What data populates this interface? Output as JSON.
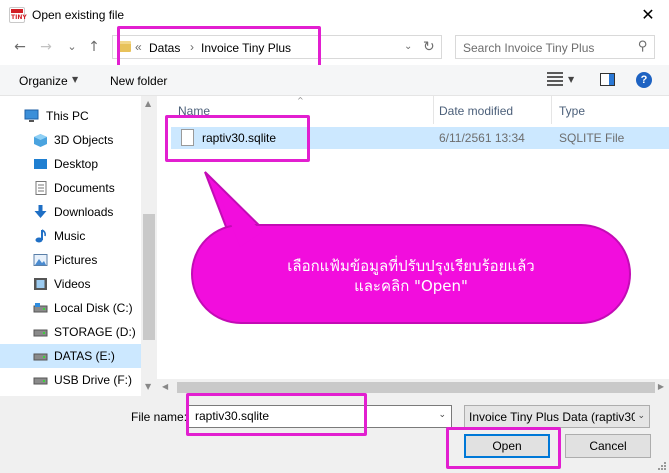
{
  "window": {
    "title": "Open existing file",
    "app_icon_text": "TINY",
    "close_glyph": "✕"
  },
  "nav": {
    "back_glyph": "←",
    "forward_glyph": "→",
    "recent_glyph": "⌄",
    "up_glyph": "↑",
    "address_chevron": "«",
    "breadcrumbs": [
      "Datas",
      "Invoice Tiny Plus"
    ],
    "breadcrumb_separator": "›",
    "dropdown_glyph": "⌄",
    "refresh_glyph": "↻",
    "search_placeholder": "Search Invoice Tiny Plus",
    "search_glyph": "⚲"
  },
  "toolbar": {
    "organize_label": "Organize",
    "organize_arrow": "▼",
    "new_folder_label": "New folder",
    "view_arrow": "▼",
    "help_label": "?"
  },
  "sidebar": {
    "items": [
      {
        "label": "This PC",
        "icon": "pc-icon"
      },
      {
        "label": "3D Objects",
        "icon": "cube-icon"
      },
      {
        "label": "Desktop",
        "icon": "desktop-icon"
      },
      {
        "label": "Documents",
        "icon": "documents-icon"
      },
      {
        "label": "Downloads",
        "icon": "download-icon"
      },
      {
        "label": "Music",
        "icon": "music-icon"
      },
      {
        "label": "Pictures",
        "icon": "pictures-icon"
      },
      {
        "label": "Videos",
        "icon": "videos-icon"
      },
      {
        "label": "Local Disk (C:)",
        "icon": "local-disk-icon"
      },
      {
        "label": "STORAGE (D:)",
        "icon": "drive-icon"
      },
      {
        "label": "DATAS (E:)",
        "icon": "drive-icon",
        "selected": true
      },
      {
        "label": "USB Drive (F:)",
        "icon": "usb-drive-icon"
      }
    ],
    "scroll_up": "▲",
    "scroll_down": "▼"
  },
  "files": {
    "columns": [
      "Name",
      "Date modified",
      "Type"
    ],
    "sort_caret": "^",
    "rows": [
      {
        "name": "raptiv30.sqlite",
        "date": "6/11/2561 13:34",
        "type": "SQLITE File"
      }
    ],
    "hscroll_left": "◀",
    "hscroll_right": "▶"
  },
  "callout": {
    "line1": "เลือกแฟ้มข้อมูลที่ปรับปรุงเรียบร้อยแล้ว",
    "line2": "และคลิก \"Open\""
  },
  "bottom": {
    "file_name_label": "File name:",
    "file_name_value": "raptiv30.sqlite",
    "file_name_dropdown": "⌄",
    "filter_value": "Invoice Tiny Plus Data (raptiv30",
    "filter_dropdown": "⌄",
    "open_label": "Open",
    "cancel_label": "Cancel"
  },
  "colors": {
    "highlight": "#e21fd0",
    "callout_fill": "#f20ddd",
    "selection": "#cce8ff",
    "accent": "#0078d7"
  }
}
